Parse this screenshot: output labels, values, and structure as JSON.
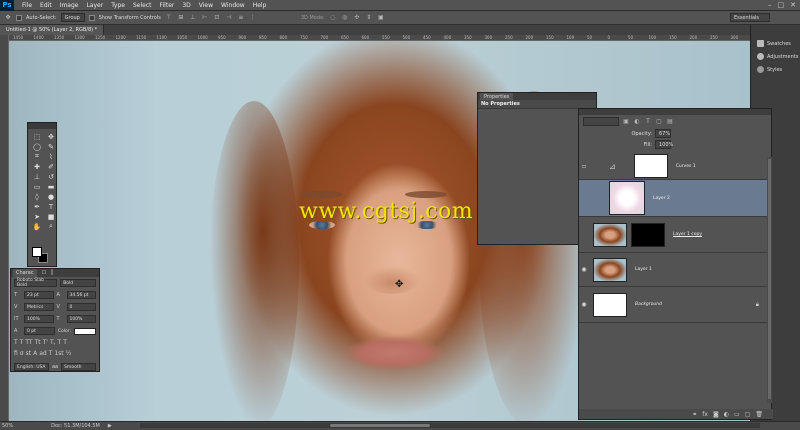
{
  "app": {
    "logo": "Ps"
  },
  "menu": [
    "File",
    "Edit",
    "Image",
    "Layer",
    "Type",
    "Select",
    "Filter",
    "3D",
    "View",
    "Window",
    "Help"
  ],
  "window_controls": [
    "–",
    "□",
    "✕"
  ],
  "options": {
    "auto_select_label": "Auto-Select:",
    "auto_select_value": "Group",
    "show_transform_label": "Show Transform Controls",
    "mode_3d_label": "3D Mode:",
    "workspace": "Essentials"
  },
  "document": {
    "tab_title": "Untitled-1 @ 50% (Layer 2, RGB/8) *"
  },
  "ruler": {
    "top_ticks": [
      "1450",
      "1400",
      "1350",
      "1300",
      "1250",
      "1200",
      "1150",
      "1100",
      "1050",
      "1000",
      "950",
      "900",
      "850",
      "800",
      "750",
      "700",
      "650",
      "600",
      "550",
      "500",
      "450",
      "400",
      "350",
      "300",
      "250",
      "200",
      "150",
      "100",
      "50",
      "0",
      "50",
      "100",
      "150",
      "200",
      "250",
      "300"
    ]
  },
  "watermark": "www.cgtsj.com",
  "right_strip": {
    "items": [
      {
        "label": "Swatches"
      },
      {
        "label": "Adjustments"
      },
      {
        "label": "Styles"
      }
    ]
  },
  "character": {
    "tabs": [
      "Charac",
      "☐",
      "⫿"
    ],
    "font_family": "Roboto Slab Bold",
    "font_style": "Bold",
    "size": "23 pt",
    "leading": "34.56 pt",
    "kerning": "Metrics",
    "tracking": "0",
    "vscale": "100%",
    "hscale": "100%",
    "baseline": "0 pt",
    "color_label": "Color:",
    "language": "English: USA",
    "antialias": "Smooth",
    "aa_prefix": "aa"
  },
  "properties": {
    "tab": "Properties",
    "empty": "No Properties"
  },
  "layers": {
    "opacity_label": "Opacity:",
    "opacity_value": "67%",
    "fill_label": "Fill:",
    "fill_value": "100%",
    "rows": [
      {
        "name": "Curves 1"
      },
      {
        "name": "Layer 2"
      },
      {
        "name": "Layer 1 copy"
      },
      {
        "name": "Layer 1"
      },
      {
        "name": "Background"
      }
    ]
  },
  "status": {
    "zoom": "50%",
    "doc": "Doc: 51.3M/104.5M"
  }
}
